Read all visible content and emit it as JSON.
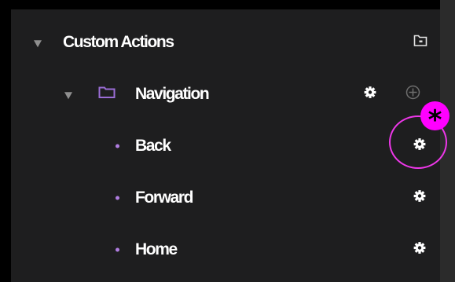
{
  "tree": {
    "root": {
      "label": "Custom Actions",
      "expanded": true,
      "action_icon": "folder-add-icon"
    },
    "folder": {
      "label": "Navigation",
      "expanded": true,
      "icon": "folder-icon",
      "action_icons": [
        "gear-icon",
        "plus-circle-icon"
      ]
    },
    "items": [
      {
        "label": "Back",
        "action_icon": "gear-icon"
      },
      {
        "label": "Forward",
        "action_icon": "gear-icon"
      },
      {
        "label": "Home",
        "action_icon": "gear-icon"
      }
    ]
  },
  "annotation": {
    "marker_text": "*",
    "highlighted_item": "Back"
  },
  "colors": {
    "panel_background": "#1e1e1f",
    "text": "#ffffff",
    "accent_purple": "#9b6dd6",
    "annotation_magenta": "#ff00ff",
    "muted_gray": "#8f8f8f"
  }
}
